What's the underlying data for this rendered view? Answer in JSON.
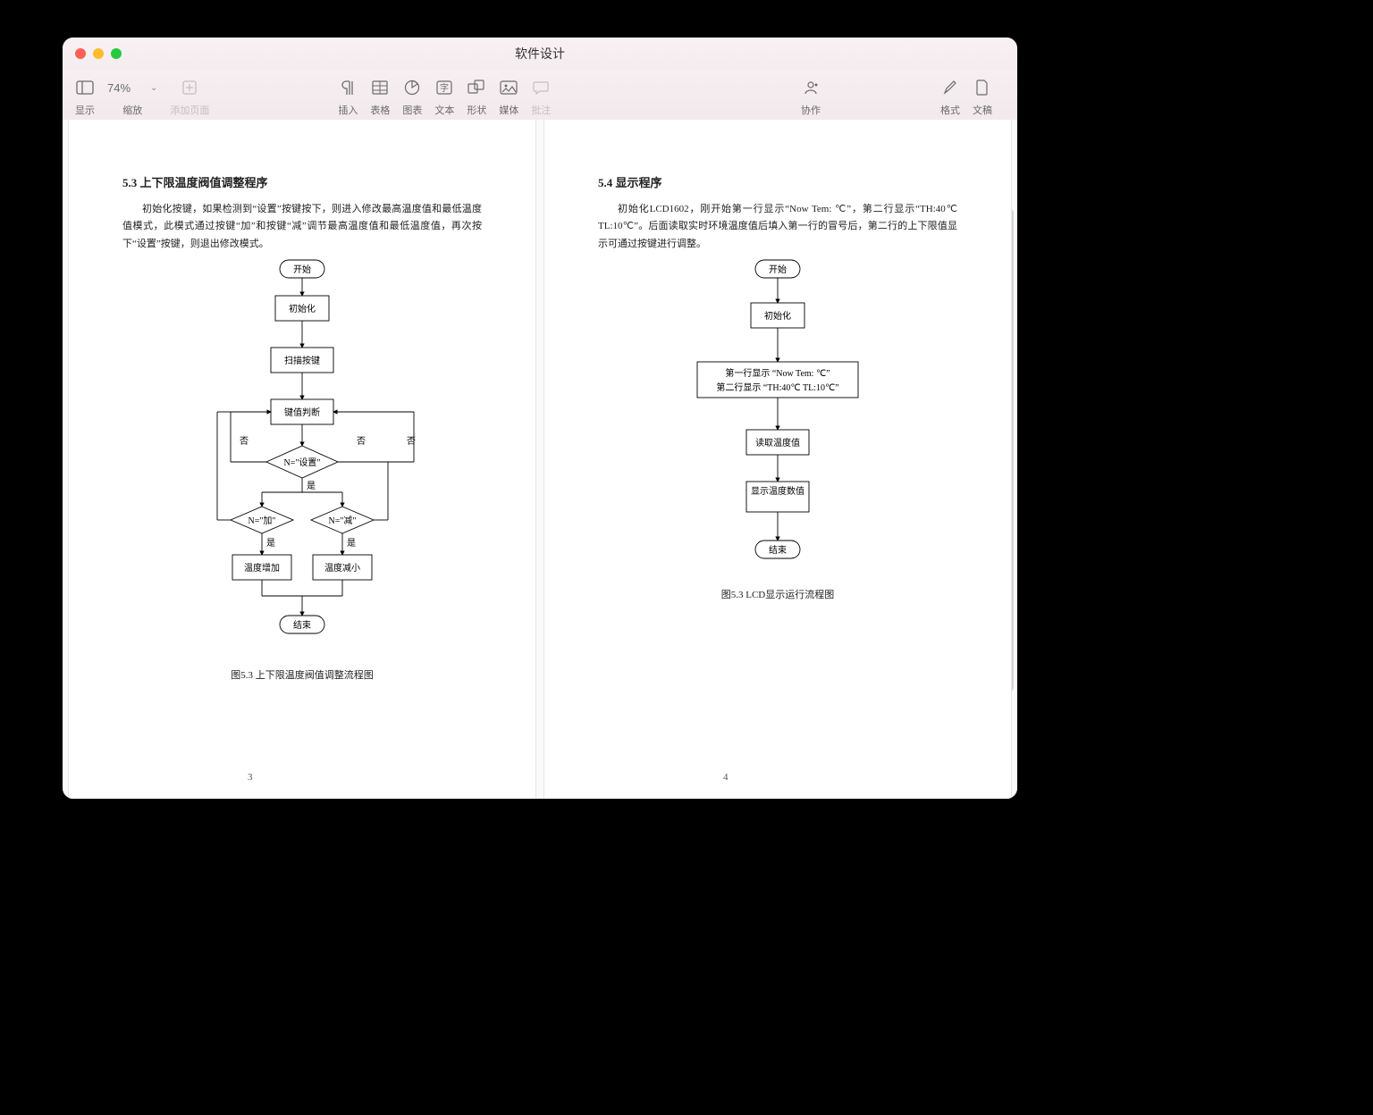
{
  "window": {
    "title": "软件设计"
  },
  "toolbar": {
    "view_label": "显示",
    "zoom_label": "缩放",
    "zoom_value": "74%",
    "addpage_label": "添加页面",
    "insert_label": "插入",
    "table_label": "表格",
    "chart_label": "图表",
    "text_label": "文本",
    "shape_label": "形状",
    "media_label": "媒体",
    "comment_label": "批注",
    "collab_label": "协作",
    "format_label": "格式",
    "document_label": "文稿"
  },
  "page1": {
    "heading": "5.3 上下限温度阀值调整程序",
    "para": "初始化按键，如果检测到“设置”按键按下，则进入修改最高温度值和最低温度值模式，此模式通过按键“加”和按键“减”调节最高温度值和最低温度值，再次按下“设置”按键，则退出修改模式。",
    "flow": {
      "start": "开始",
      "init": "初始化",
      "scan": "扫描按键",
      "judge": "键值判断",
      "dset": "N=\"设置\"",
      "dyes1": "是",
      "dno1": "否",
      "dno2": "否",
      "dno3": "否",
      "dadd": "N=\"加\"",
      "dsub": "N=\"减\"",
      "yes2": "是",
      "yes3": "是",
      "inc": "温度增加",
      "dec": "温度减小",
      "end": "结束"
    },
    "caption": "图5.3  上下限温度阀值调整流程图",
    "pagenum": "3"
  },
  "page2": {
    "heading": "5.4 显示程序",
    "para": "初始化LCD1602，刚开始第一行显示“Now Tem:    ℃”，第二行显示“TH:40℃ TL:10℃”。后面读取实时环境温度值后填入第一行的冒号后，第二行的上下限值显示可通过按键进行调整。",
    "flow": {
      "start": "开始",
      "init": "初始化",
      "disp_l1": "第一行显示 “Now Tem:   ℃”",
      "disp_l2": "第二行显示 “TH:40℃  TL:10℃”",
      "read": "读取温度值",
      "show": "显示温度数值",
      "end": "结束"
    },
    "caption": "图5.3  LCD显示运行流程图",
    "pagenum": "4"
  }
}
